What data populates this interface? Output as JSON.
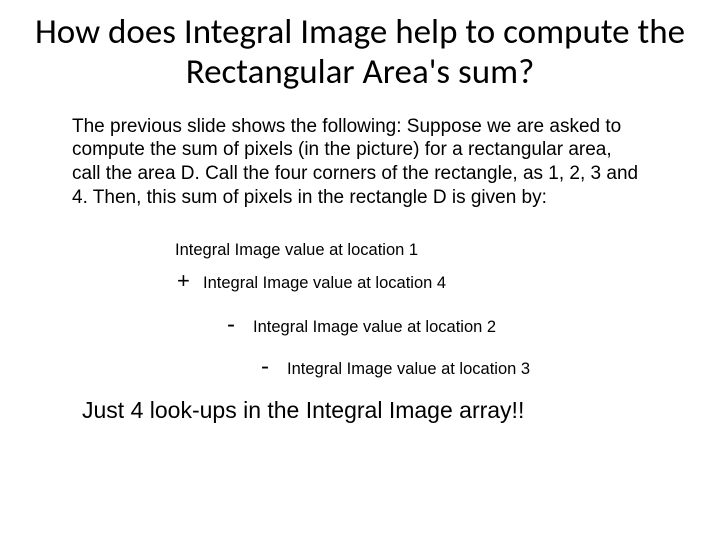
{
  "title": "How does Integral Image help to compute the Rectangular Area's sum?",
  "body": "The previous slide shows the following: Suppose we are asked to compute the sum of pixels  (in the picture) for a rectangular area, call the area D.  Call the four corners of the rectangle, as 1, 2, 3 and 4. Then, this sum of pixels in the rectangle D is given by:",
  "formula": {
    "line1": "Integral Image value  at location 1",
    "op_plus": "+",
    "line2": "Integral Image value  at location 4",
    "op_minus1": "-",
    "line3": "Integral Image value  at  location 2",
    "op_minus2": "-",
    "line4": "Integral Image value  at location 3"
  },
  "conclusion": "Just 4 look-ups in the Integral Image array!!"
}
